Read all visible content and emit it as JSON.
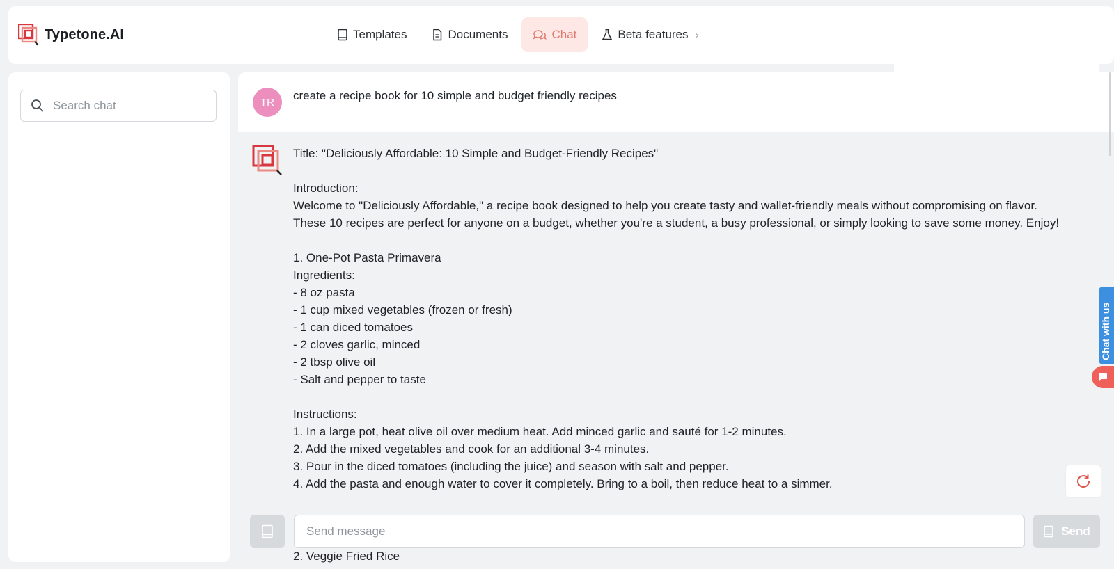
{
  "brand": {
    "name": "Typetone.AI",
    "accent": "#d9363e"
  },
  "nav": {
    "items": [
      {
        "label": "Templates",
        "icon": "book-icon",
        "active": false
      },
      {
        "label": "Documents",
        "icon": "document-icon",
        "active": false
      },
      {
        "label": "Chat",
        "icon": "chat-icon",
        "active": true
      },
      {
        "label": "Beta features",
        "icon": "flask-icon",
        "active": false
      }
    ]
  },
  "sidebar": {
    "search_placeholder": "Search chat"
  },
  "chat": {
    "user": {
      "initials": "TR",
      "message": "create a recipe book for 10 simple and budget friendly recipes"
    },
    "bot": {
      "title": "Title: \"Deliciously Affordable: 10 Simple and Budget-Friendly Recipes\"",
      "intro_heading": "Introduction:",
      "intro_text": "Welcome to \"Deliciously Affordable,\" a recipe book designed to help you create tasty and wallet-friendly meals without compromising on flavor. These 10 recipes are perfect for anyone on a budget, whether you're a student, a busy professional, or simply looking to save some money. Enjoy!",
      "recipe1_name": "1. One-Pot Pasta Primavera",
      "ingredients_heading": "Ingredients:",
      "ingredients": [
        "- 8 oz pasta",
        "- 1 cup mixed vegetables (frozen or fresh)",
        "- 1 can diced tomatoes",
        "- 2 cloves garlic, minced",
        "- 2 tbsp olive oil",
        "- Salt and pepper to taste"
      ],
      "instructions_heading": "Instructions:",
      "instructions": [
        "1. In a large pot, heat olive oil over medium heat. Add minced garlic and sauté for 1-2 minutes.",
        "2. Add the mixed vegetables and cook for an additional 3-4 minutes.",
        "3. Pour in the diced tomatoes (including the juice) and season with salt and pepper.",
        "4. Add the pasta and enough water to cover it completely. Bring to a boil, then reduce heat to a simmer."
      ],
      "next_recipe": "2. Veggie Fried Rice"
    }
  },
  "composer": {
    "placeholder": "Send message",
    "send_label": "Send"
  },
  "widget": {
    "chat_with_us": "Chat with us"
  }
}
